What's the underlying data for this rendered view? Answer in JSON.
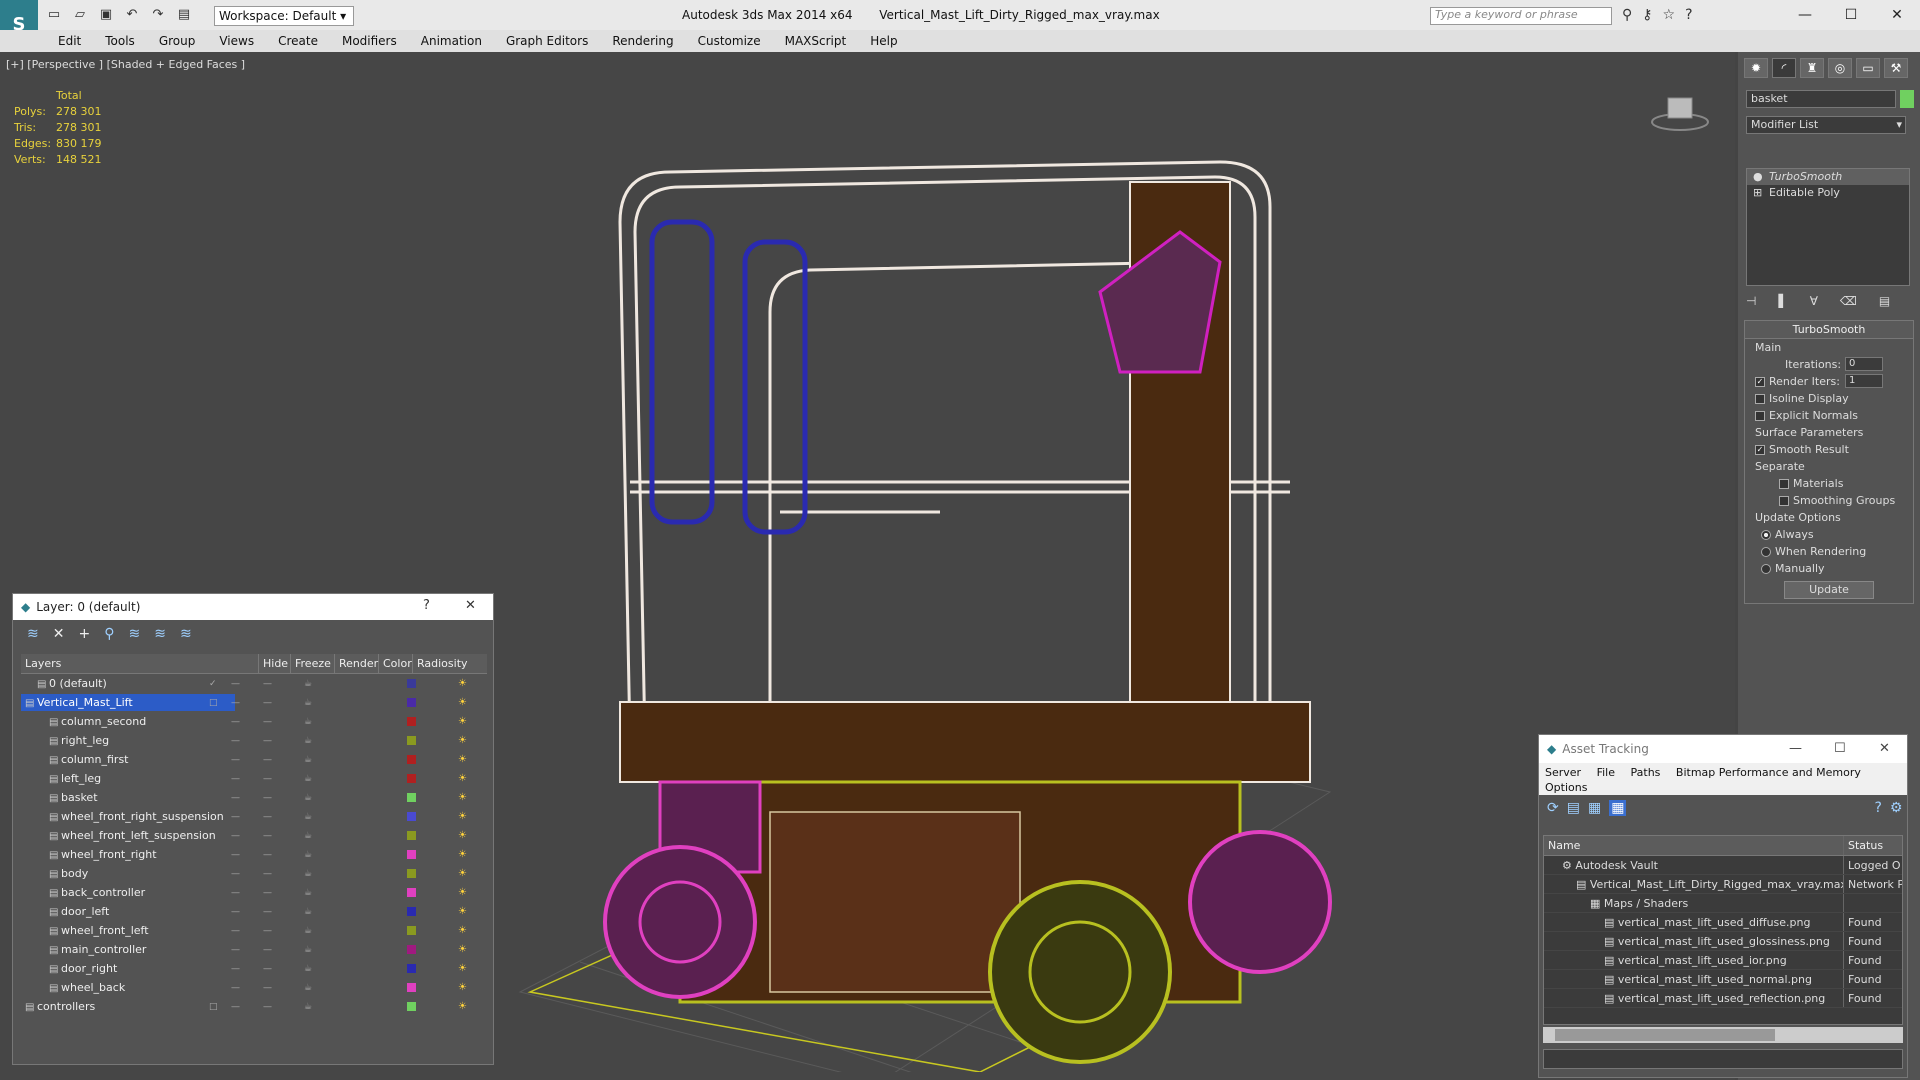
{
  "titlebar": {
    "workspace": "Workspace: Default",
    "app": "Autodesk 3ds Max  2014 x64",
    "file": "Vertical_Mast_Lift_Dirty_Rigged_max_vray.max",
    "search_placeholder": "Type a keyword or phrase"
  },
  "menu": [
    "Edit",
    "Tools",
    "Group",
    "Views",
    "Create",
    "Modifiers",
    "Animation",
    "Graph Editors",
    "Rendering",
    "Customize",
    "MAXScript",
    "Help"
  ],
  "viewport": {
    "label": "[+] [Perspective ] [Shaded + Edged Faces ]",
    "stats": {
      "header": "Total",
      "rows": [
        {
          "label": "Polys:",
          "value": "278 301"
        },
        {
          "label": "Tris:",
          "value": "278 301"
        },
        {
          "label": "Edges:",
          "value": "830 179"
        },
        {
          "label": "Verts:",
          "value": "148 521"
        }
      ]
    }
  },
  "layer_dialog": {
    "title": "Layer: 0 (default)",
    "columns": [
      "Layers",
      "Hide",
      "Freeze",
      "Render",
      "Color",
      "Radiosity"
    ],
    "rows": [
      {
        "name": "0 (default)",
        "level": 1,
        "color": "#3a3a9a"
      },
      {
        "name": "Vertical_Mast_Lift",
        "level": 0,
        "color": "#4a2aa8",
        "selected": true
      },
      {
        "name": "column_second",
        "level": 2,
        "color": "#b02020"
      },
      {
        "name": "right_leg",
        "level": 2,
        "color": "#8a9a20"
      },
      {
        "name": "column_first",
        "level": 2,
        "color": "#b02020"
      },
      {
        "name": "left_leg",
        "level": 2,
        "color": "#b02020"
      },
      {
        "name": "basket",
        "level": 2,
        "color": "#70d060"
      },
      {
        "name": "wheel_front_right_suspension",
        "level": 2,
        "color": "#4a4ad0"
      },
      {
        "name": "wheel_front_left_suspension",
        "level": 2,
        "color": "#8a9a20"
      },
      {
        "name": "wheel_front_right",
        "level": 2,
        "color": "#e040c0"
      },
      {
        "name": "body",
        "level": 2,
        "color": "#8a9a20"
      },
      {
        "name": "back_controller",
        "level": 2,
        "color": "#e040c0"
      },
      {
        "name": "door_left",
        "level": 2,
        "color": "#2a2ab0"
      },
      {
        "name": "wheel_front_left",
        "level": 2,
        "color": "#8a9a20"
      },
      {
        "name": "main_controller",
        "level": 2,
        "color": "#a01a80"
      },
      {
        "name": "door_right",
        "level": 2,
        "color": "#2a2ab0"
      },
      {
        "name": "wheel_back",
        "level": 2,
        "color": "#e040c0"
      },
      {
        "name": "controllers",
        "level": 0,
        "color": "#70d060"
      }
    ]
  },
  "command_panel": {
    "object_name": "basket",
    "modifier_list": "Modifier List",
    "stack": [
      "TurboSmooth",
      "Editable Poly"
    ],
    "turbosmooth": {
      "title": "TurboSmooth",
      "main": "Main",
      "iterations_label": "Iterations:",
      "iterations": "0",
      "render_iters_label": "Render Iters:",
      "render_iters": "1",
      "isoline": "Isoline Display",
      "explicit": "Explicit Normals",
      "surface": "Surface Parameters",
      "smooth_result": "Smooth Result",
      "separate": "Separate",
      "materials": "Materials",
      "smoothing_groups": "Smoothing Groups",
      "update_options": "Update Options",
      "always": "Always",
      "when_rendering": "When Rendering",
      "manually": "Manually",
      "update": "Update"
    }
  },
  "asset_tracking": {
    "title": "Asset Tracking",
    "menu1": [
      "Server",
      "File",
      "Paths",
      "Bitmap Performance and Memory"
    ],
    "menu2": [
      "Options"
    ],
    "columns": [
      "Name",
      "Status"
    ],
    "rows": [
      {
        "name": "Autodesk Vault",
        "status": "Logged O",
        "indent": 1
      },
      {
        "name": "Vertical_Mast_Lift_Dirty_Rigged_max_vray.max",
        "status": "Network P",
        "indent": 2
      },
      {
        "name": "Maps / Shaders",
        "status": "",
        "indent": 3
      },
      {
        "name": "vertical_mast_lift_used_diffuse.png",
        "status": "Found",
        "indent": 4
      },
      {
        "name": "vertical_mast_lift_used_glossiness.png",
        "status": "Found",
        "indent": 4
      },
      {
        "name": "vertical_mast_lift_used_ior.png",
        "status": "Found",
        "indent": 4
      },
      {
        "name": "vertical_mast_lift_used_normal.png",
        "status": "Found",
        "indent": 4
      },
      {
        "name": "vertical_mast_lift_used_reflection.png",
        "status": "Found",
        "indent": 4
      }
    ]
  }
}
